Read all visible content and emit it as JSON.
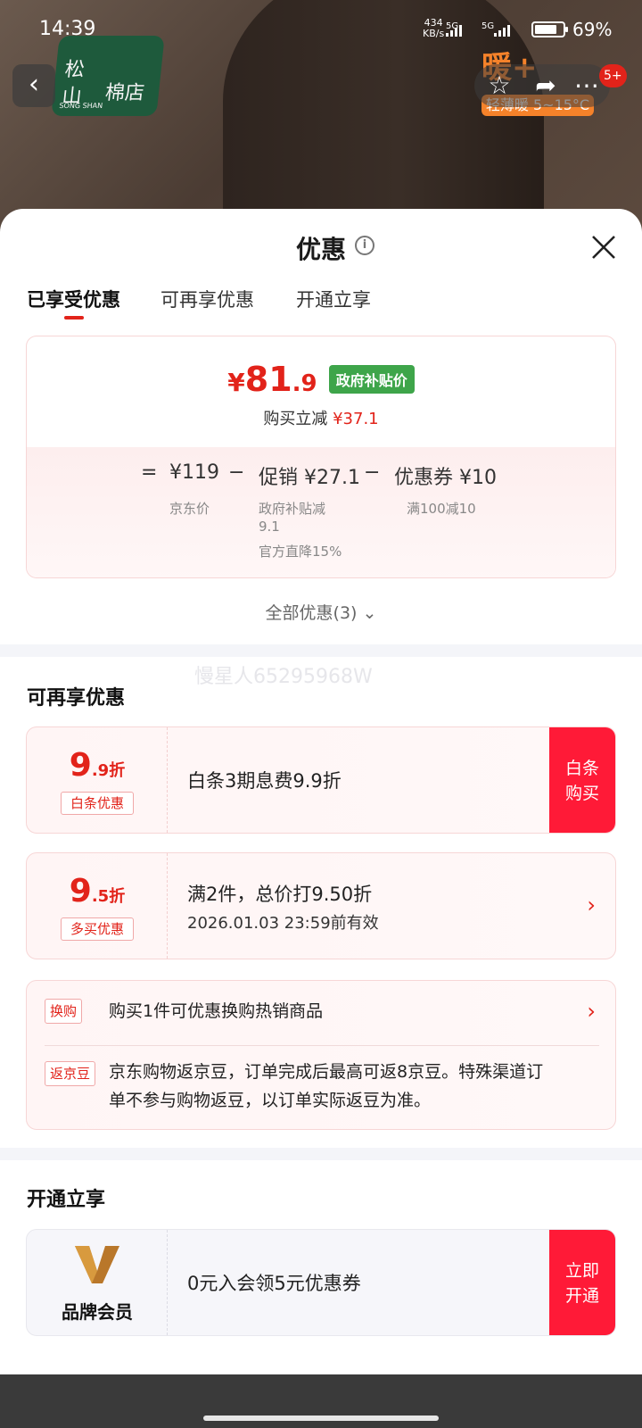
{
  "status_bar": {
    "time": "14:39",
    "net_speed": "434",
    "net_unit": "KB/s",
    "sig1": "5G",
    "sig2": "5G",
    "battery": "69%"
  },
  "shop": {
    "logo_line1": "松",
    "logo_line2": "山",
    "logo_line3": "棉店",
    "logo_sub": "SONG SHAN",
    "promo": "暖+",
    "promo_sub": "轻薄暖 5~15°C",
    "badge": "5+"
  },
  "sheet": {
    "title": "优惠",
    "tabs": [
      "已享受优惠",
      "可再享优惠",
      "开通立享"
    ]
  },
  "price_card": {
    "currency": "¥",
    "price_int": "81",
    "price_dec": ".9",
    "gov_tag": "政府补贴价",
    "reduce_label": "购买立减",
    "reduce_amount": "¥37.1",
    "eq": "=",
    "minus": "−",
    "jd_price": "¥119",
    "jd_label": "京东价",
    "promo_price": "促销 ¥27.1",
    "promo_note1": "政府补贴减",
    "promo_note2": "9.1",
    "promo_note3": "官方直降15%",
    "coupon_price": "优惠券 ¥10",
    "coupon_note": "满100减10"
  },
  "all_offers": "全部优惠(3)",
  "watermark": "慢星人65295968W",
  "more_offers": {
    "title": "可再享优惠",
    "items": [
      {
        "big": "9",
        "small": ".9折",
        "tag": "白条优惠",
        "text": "白条3期息费9.9折",
        "button": [
          "白条",
          "购买"
        ]
      },
      {
        "big": "9",
        "small": ".5折",
        "tag": "多买优惠",
        "text": "满2件，总价打9.50折",
        "sub": "2026.01.03 23:59前有效"
      }
    ],
    "exchange_tag": "换购",
    "exchange_text": "购买1件可优惠换购热销商品",
    "bean_tag": "返京豆",
    "bean_line1": "京东购物返京豆，订单完成后最高可返8京豆。特殊渠道订",
    "bean_line2": "单不参与购物返豆，以订单实际返豆为准。"
  },
  "open_section": {
    "title": "开通立享",
    "member_label": "品牌会员",
    "text": "0元入会领5元优惠券",
    "button": [
      "立即",
      "开通"
    ]
  },
  "colors": {
    "accent_red": "#e2231a",
    "button_red": "#ff1a37",
    "gov_green": "#3ea54a"
  }
}
